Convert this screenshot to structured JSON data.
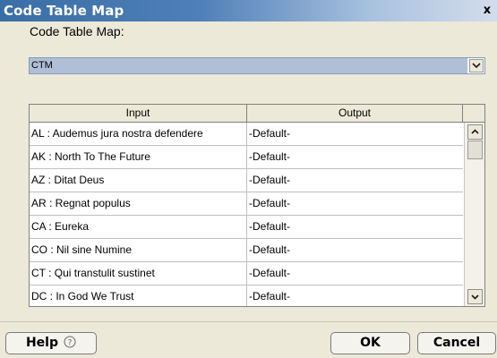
{
  "window": {
    "title": "Code Table Map",
    "close_symbol": "x"
  },
  "code_table_map": {
    "label": "Code Table Map:",
    "value": "CTM"
  },
  "table": {
    "headers": [
      "Input",
      "Output"
    ],
    "rows": [
      {
        "input": "AL : Audemus jura nostra defendere",
        "output": "-Default-"
      },
      {
        "input": "AK : North To The Future",
        "output": "-Default-"
      },
      {
        "input": "AZ : Ditat Deus",
        "output": "-Default-"
      },
      {
        "input": "AR : Regnat populus",
        "output": "-Default-"
      },
      {
        "input": "CA : Eureka",
        "output": "-Default-"
      },
      {
        "input": "CO : Nil sine Numine",
        "output": "-Default-"
      },
      {
        "input": "CT : Qui transtulit sustinet",
        "output": "-Default-"
      },
      {
        "input": "DC : In God We Trust",
        "output": "-Default-"
      }
    ]
  },
  "buttons": {
    "help": "Help",
    "help_icon": "?",
    "ok": "OK",
    "cancel": "Cancel"
  },
  "icons": {
    "dropdown": "chevron-down-icon",
    "scroll_up": "chevron-up-icon",
    "scroll_down": "chevron-down-icon",
    "help": "question-circle-icon",
    "close": "close-icon"
  },
  "colors": {
    "title_bar_start": "#3a6ea5",
    "title_bar_end": "#d4dcec",
    "selected_value_bg": "#b0bed6",
    "window_bg": "#ece9d8"
  }
}
